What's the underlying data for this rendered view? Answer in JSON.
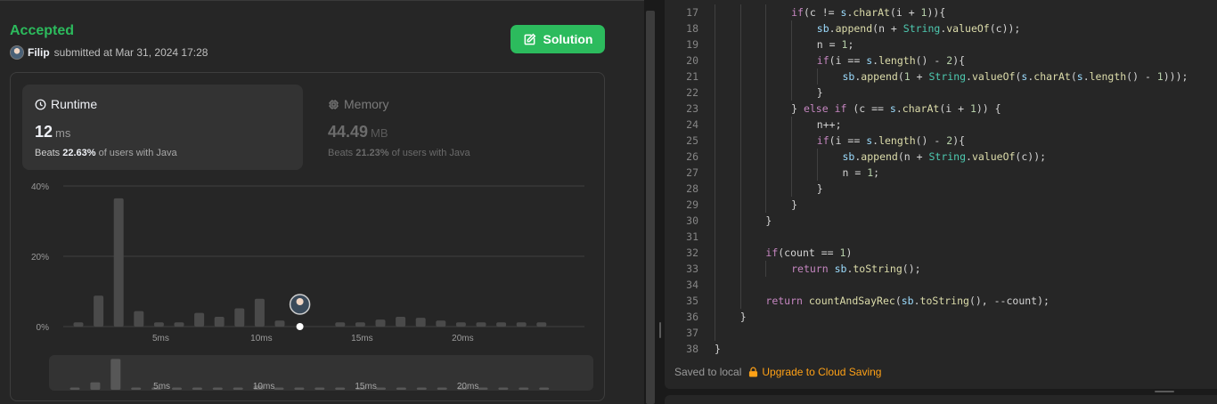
{
  "submission": {
    "status": "Accepted",
    "username": "Filip",
    "submitted_text": "submitted at Mar 31, 2024 17:28",
    "solution_label": "Solution"
  },
  "runtime": {
    "title": "Runtime",
    "value": "12",
    "unit": "ms",
    "beats_prefix": "Beats",
    "beats_pct": "22.63%",
    "beats_suffix": "of users with Java"
  },
  "memory": {
    "title": "Memory",
    "value": "44.49",
    "unit": "MB",
    "beats_prefix": "Beats",
    "beats_pct": "21.23%",
    "beats_suffix": "of users with Java"
  },
  "chart_data": {
    "type": "bar",
    "ylabel_ticks": [
      "40%",
      "20%",
      "0%"
    ],
    "ylim": [
      0,
      40
    ],
    "x_tick_labels": [
      "5ms",
      "10ms",
      "15ms",
      "20ms"
    ],
    "x_tick_positions": [
      5,
      10,
      15,
      20
    ],
    "x": [
      1,
      2,
      3,
      4,
      5,
      6,
      7,
      8,
      9,
      10,
      11,
      12,
      13,
      14,
      15,
      16,
      17,
      18,
      19,
      20,
      21,
      22,
      23,
      24
    ],
    "values": [
      1.2,
      8.8,
      36.5,
      4.4,
      1.2,
      1.2,
      3.9,
      2.8,
      5.2,
      7.9,
      1.7,
      1.2,
      0,
      1.2,
      1.2,
      2.0,
      2.8,
      2.5,
      1.7,
      1.2,
      1.2,
      1.2,
      1.2,
      1.2
    ],
    "highlight_x": 12,
    "grid": true,
    "mini_values": [
      1.2,
      8.8,
      36.5,
      1.2,
      1.2,
      1.2,
      1.2,
      1.2,
      1.2,
      5.0,
      1.2,
      1.2,
      1.2,
      1.2,
      1.2,
      1.2,
      1.2,
      1.2,
      1.2,
      1.2,
      1.2,
      1.2,
      1.2,
      1.2
    ]
  },
  "editor": {
    "lines": [
      {
        "n": "17",
        "indent": 3,
        "tokens": [
          [
            "kw",
            "if"
          ],
          [
            "",
            "(c != "
          ],
          [
            "vr",
            "s"
          ],
          [
            "",
            "."
          ],
          [
            "fn",
            "charAt"
          ],
          [
            "",
            "(i + "
          ],
          [
            "nu",
            "1"
          ],
          [
            "",
            "))"
          ],
          [
            "",
            "{"
          ]
        ]
      },
      {
        "n": "18",
        "indent": 4,
        "tokens": [
          [
            "vr",
            "sb"
          ],
          [
            "",
            "."
          ],
          [
            "fn",
            "append"
          ],
          [
            "",
            "(n + "
          ],
          [
            "ty",
            "String"
          ],
          [
            "",
            "."
          ],
          [
            "fn",
            "valueOf"
          ],
          [
            "",
            "(c));"
          ]
        ]
      },
      {
        "n": "19",
        "indent": 4,
        "tokens": [
          [
            "",
            "n = "
          ],
          [
            "nu",
            "1"
          ],
          [
            "",
            ";"
          ]
        ]
      },
      {
        "n": "20",
        "indent": 4,
        "tokens": [
          [
            "kw",
            "if"
          ],
          [
            "",
            "(i == "
          ],
          [
            "vr",
            "s"
          ],
          [
            "",
            "."
          ],
          [
            "fn",
            "length"
          ],
          [
            "",
            "() - "
          ],
          [
            "nu",
            "2"
          ],
          [
            "",
            "){"
          ]
        ]
      },
      {
        "n": "21",
        "indent": 5,
        "tokens": [
          [
            "vr",
            "sb"
          ],
          [
            "",
            "."
          ],
          [
            "fn",
            "append"
          ],
          [
            "",
            "("
          ],
          [
            "nu",
            "1"
          ],
          [
            "",
            " + "
          ],
          [
            "ty",
            "String"
          ],
          [
            "",
            "."
          ],
          [
            "fn",
            "valueOf"
          ],
          [
            "",
            "("
          ],
          [
            "vr",
            "s"
          ],
          [
            "",
            "."
          ],
          [
            "fn",
            "charAt"
          ],
          [
            "",
            "("
          ],
          [
            "vr",
            "s"
          ],
          [
            "",
            "."
          ],
          [
            "fn",
            "length"
          ],
          [
            "",
            "() - "
          ],
          [
            "nu",
            "1"
          ],
          [
            "",
            ")));"
          ]
        ]
      },
      {
        "n": "22",
        "indent": 4,
        "tokens": [
          [
            "",
            "}"
          ]
        ]
      },
      {
        "n": "23",
        "indent": 3,
        "tokens": [
          [
            "",
            "} "
          ],
          [
            "kw",
            "else if"
          ],
          [
            "",
            " (c == "
          ],
          [
            "vr",
            "s"
          ],
          [
            "",
            "."
          ],
          [
            "fn",
            "charAt"
          ],
          [
            "",
            "(i + "
          ],
          [
            "nu",
            "1"
          ],
          [
            "",
            ")) {"
          ]
        ]
      },
      {
        "n": "24",
        "indent": 4,
        "tokens": [
          [
            "",
            "n++;"
          ]
        ]
      },
      {
        "n": "25",
        "indent": 4,
        "tokens": [
          [
            "kw",
            "if"
          ],
          [
            "",
            "(i == "
          ],
          [
            "vr",
            "s"
          ],
          [
            "",
            "."
          ],
          [
            "fn",
            "length"
          ],
          [
            "",
            "() - "
          ],
          [
            "nu",
            "2"
          ],
          [
            "",
            "){"
          ]
        ]
      },
      {
        "n": "26",
        "indent": 5,
        "tokens": [
          [
            "vr",
            "sb"
          ],
          [
            "",
            "."
          ],
          [
            "fn",
            "append"
          ],
          [
            "",
            "(n + "
          ],
          [
            "ty",
            "String"
          ],
          [
            "",
            "."
          ],
          [
            "fn",
            "valueOf"
          ],
          [
            "",
            "(c));"
          ]
        ]
      },
      {
        "n": "27",
        "indent": 5,
        "tokens": [
          [
            "",
            "n = "
          ],
          [
            "nu",
            "1"
          ],
          [
            "",
            ";"
          ]
        ]
      },
      {
        "n": "28",
        "indent": 4,
        "tokens": [
          [
            "",
            "}"
          ]
        ]
      },
      {
        "n": "29",
        "indent": 3,
        "tokens": [
          [
            "",
            "}"
          ]
        ]
      },
      {
        "n": "30",
        "indent": 2,
        "tokens": [
          [
            "",
            "}"
          ]
        ]
      },
      {
        "n": "31",
        "indent": 2,
        "tokens": []
      },
      {
        "n": "32",
        "indent": 2,
        "tokens": [
          [
            "kw",
            "if"
          ],
          [
            "",
            "(count == "
          ],
          [
            "nu",
            "1"
          ],
          [
            "",
            ")"
          ]
        ]
      },
      {
        "n": "33",
        "indent": 3,
        "tokens": [
          [
            "kw",
            "return"
          ],
          [
            "",
            " "
          ],
          [
            "vr",
            "sb"
          ],
          [
            "",
            "."
          ],
          [
            "fn",
            "toString"
          ],
          [
            "",
            "();"
          ]
        ]
      },
      {
        "n": "34",
        "indent": 2,
        "tokens": []
      },
      {
        "n": "35",
        "indent": 2,
        "tokens": [
          [
            "kw",
            "return"
          ],
          [
            "",
            " "
          ],
          [
            "fn",
            "countAndSayRec"
          ],
          [
            "",
            "("
          ],
          [
            "vr",
            "sb"
          ],
          [
            "",
            "."
          ],
          [
            "fn",
            "toString"
          ],
          [
            "",
            "(), --count);"
          ]
        ]
      },
      {
        "n": "36",
        "indent": 1,
        "tokens": [
          [
            "",
            "}"
          ]
        ]
      },
      {
        "n": "37",
        "indent": 1,
        "tokens": []
      },
      {
        "n": "38",
        "indent": 0,
        "tokens": [
          [
            "",
            "}"
          ]
        ]
      }
    ],
    "saved_text": "Saved to local",
    "upgrade_text": "Upgrade to Cloud Saving"
  },
  "colors": {
    "accent_green": "#2cbb5d",
    "accent_orange": "#ffa116",
    "bar": "#4a4a4a",
    "bar_highlight": "#ffffff"
  }
}
